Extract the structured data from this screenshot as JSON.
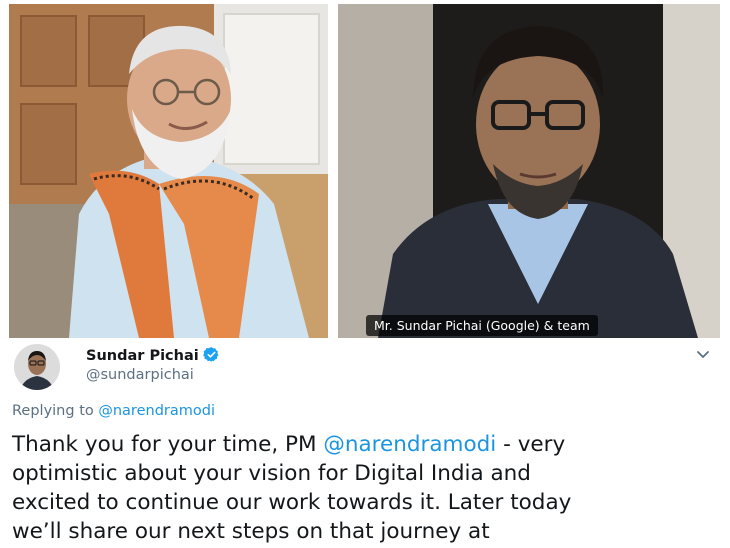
{
  "video_call": {
    "left_tile": {
      "subject": "man with white beard and glasses in light blue kurta with patterned orange shawl"
    },
    "right_tile": {
      "subject": "man with glasses and beard in blue shirt and dark blazer",
      "caption": "Mr. Sundar Pichai (Google) & team"
    }
  },
  "tweet": {
    "author_name": "Sundar Pichai",
    "author_handle": "@sundarpichai",
    "verified_icon": "verified-badge-icon",
    "menu_icon": "chevron-down-icon",
    "replying_prefix": "Replying to",
    "replying_to": "@narendramodi",
    "text": {
      "line1_before": "Thank you for your time, PM ",
      "line1_mention": "@narendramodi",
      "line1_after": " - very",
      "line2": "optimistic about your vision for Digital India and",
      "line3": "excited to continue our work towards it. Later today",
      "line4": "we’ll share our next steps on that journey at"
    },
    "colors": {
      "link": "#1b95e0",
      "secondary": "#5b7083",
      "text": "#14171a",
      "verified": "#1da1f2"
    }
  }
}
